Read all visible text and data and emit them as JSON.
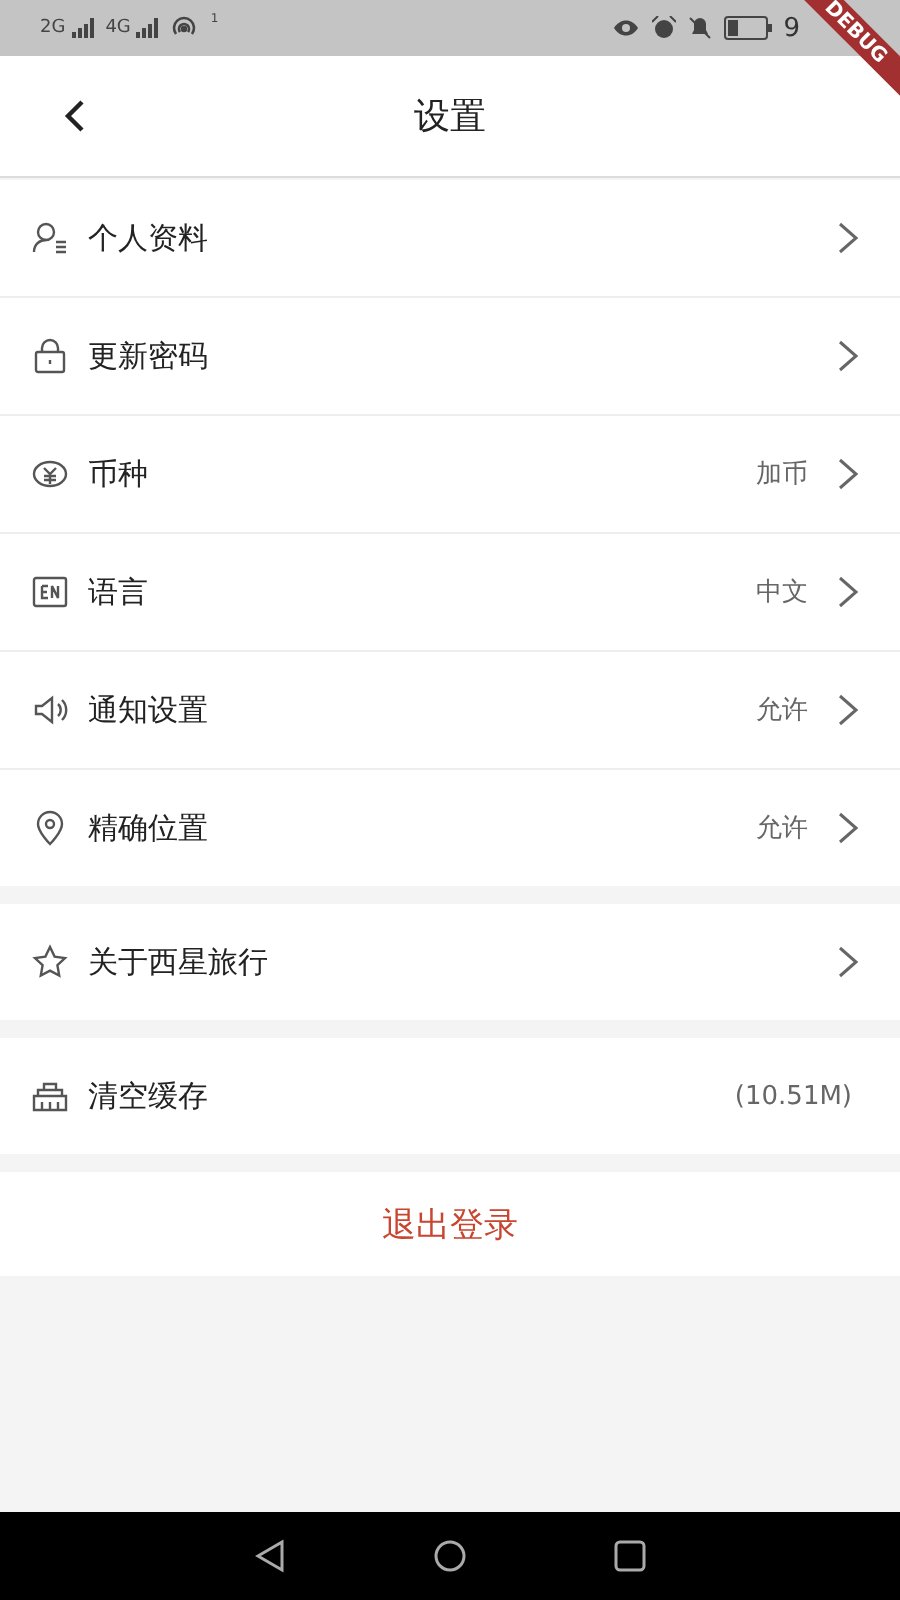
{
  "status_bar": {
    "network_1": "2G",
    "network_2": "4G",
    "hotspot_count": "1",
    "time": "9",
    "debug_banner": "DEBUG"
  },
  "header": {
    "title": "设置"
  },
  "sections": [
    {
      "rows": [
        {
          "label": "个人资料",
          "chevron": true
        },
        {
          "label": "更新密码",
          "chevron": true
        },
        {
          "label": "币种",
          "value": "加币",
          "chevron": true
        },
        {
          "label": "语言",
          "value": "中文",
          "chevron": true
        },
        {
          "label": "通知设置",
          "value": "允许",
          "chevron": true
        },
        {
          "label": "精确位置",
          "value": "允许",
          "chevron": true
        }
      ]
    },
    {
      "rows": [
        {
          "label": "关于西星旅行",
          "chevron": true
        }
      ]
    },
    {
      "rows": [
        {
          "label": "清空缓存",
          "value": "(10.51M)",
          "chevron": false
        }
      ]
    }
  ],
  "logout": {
    "label": "退出登录"
  }
}
